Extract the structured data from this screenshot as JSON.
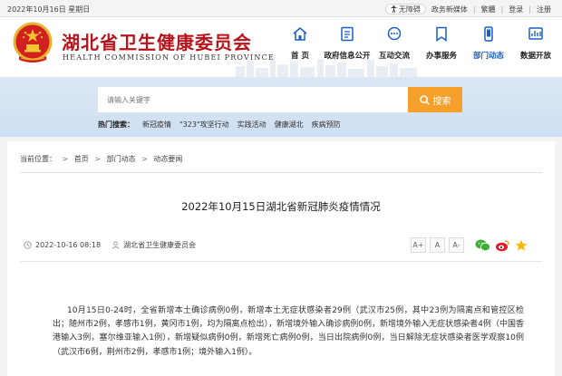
{
  "topbar": {
    "date": "2022年10月16日 星期日",
    "accessibility": "无障碍",
    "links": [
      "政务新媒体",
      "繁體",
      "登录",
      "注册"
    ]
  },
  "header": {
    "title": "湖北省卫生健康委员会",
    "subtitle": "HEALTH COMMISSION OF HUBEI PROVINCE",
    "brand_color": "#b8131a"
  },
  "nav": {
    "items": [
      {
        "label": "首 页",
        "icon": "home-icon"
      },
      {
        "label": "政府信息公开",
        "icon": "document-icon"
      },
      {
        "label": "互动交流",
        "icon": "chat-icon"
      },
      {
        "label": "办事服务",
        "icon": "bookmark-icon"
      },
      {
        "label": "部门动态",
        "icon": "mobile-icon"
      },
      {
        "label": "数据开放",
        "icon": "data-icon"
      }
    ],
    "active_color": "#1a5ec7"
  },
  "search": {
    "placeholder": "请输入关键字",
    "button_label": "搜索",
    "hot_label": "热门搜索：",
    "hot_terms": [
      "新冠疫情",
      "\"323\"攻坚行动",
      "实践活动",
      "健康湖北",
      "疾病预防"
    ]
  },
  "breadcrumb": {
    "label": "当前位置：",
    "items": [
      "首页",
      "部门动态",
      "动态要闻"
    ]
  },
  "article": {
    "title": "2022年10月15日湖北省新冠肺炎疫情情况",
    "datetime": "2022-10-16 08:18",
    "source": "湖北省卫生健康委员会",
    "font_buttons": [
      "A+",
      "A",
      "A-"
    ],
    "body": "10月15日0-24时，全省新增本土确诊病例0例，新增本土无症状感染者29例（武汉市25例，其中23例为隔离点和管控区检出；随州市2例，孝感市1例，黄冈市1例，均为隔离点检出），新增境外输入确诊病例0例，新增境外输入无症状感染者4例（中国香港输入3例，塞尔维亚输入1例），新增疑似病例0例，新增死亡病例0例，当日出院病例0例，当日解除无症状感染者医学观察10例（武汉市6例，荆州市2例，孝感市1例；境外输入1例）。"
  }
}
